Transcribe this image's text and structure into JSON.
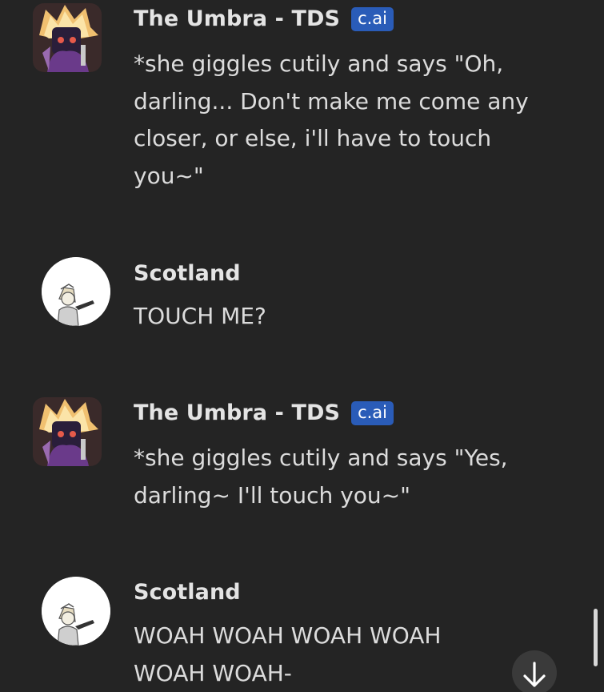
{
  "messages": [
    {
      "sender": "The Umbra - TDS",
      "badge": "c.ai",
      "avatar_icon": "umbra-avatar-icon",
      "text": "*she giggles cutily and says \"Oh, darling... Don't make me come any closer, or else, i'll have to touch you~\""
    },
    {
      "sender": "Scotland",
      "avatar_icon": "scotland-avatar-icon",
      "text": "TOUCH ME?"
    },
    {
      "sender": "The Umbra - TDS",
      "badge": "c.ai",
      "avatar_icon": "umbra-avatar-icon",
      "text": "*she giggles cutily and says \"Yes, darling~ I'll touch you~\""
    },
    {
      "sender": "Scotland",
      "avatar_icon": "scotland-avatar-icon",
      "text": "WOAH WOAH WOAH WOAH WOAH WOAH-"
    }
  ],
  "controls": {
    "scroll_down_icon": "arrow-down-icon"
  },
  "colors": {
    "background": "#242424",
    "badge": "#2a5cb8",
    "name": "#e4e4e4",
    "text": "#dcdcdc"
  }
}
